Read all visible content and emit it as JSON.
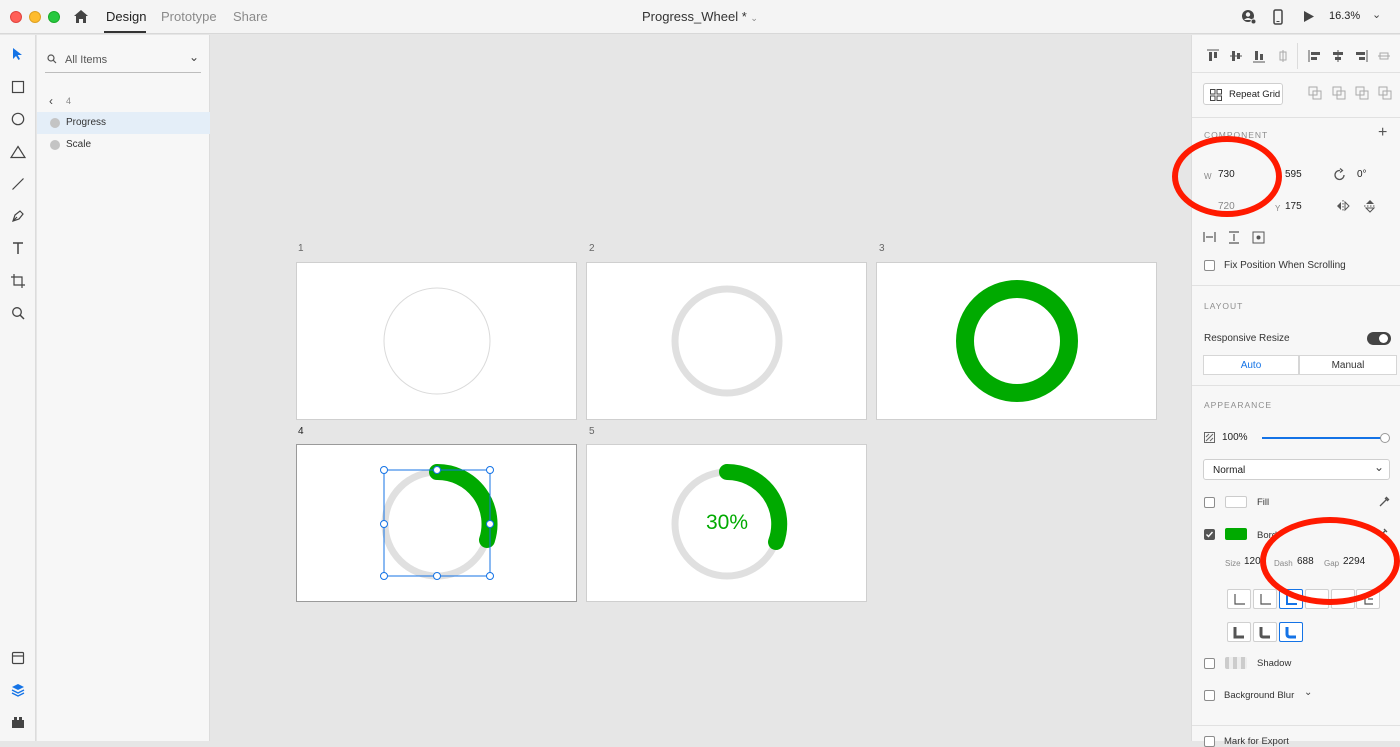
{
  "titlebar": {
    "tabs": [
      "Design",
      "Prototype",
      "Share"
    ],
    "doc_title": "Progress_Wheel *",
    "zoom": "16.3%"
  },
  "layers": {
    "search_placeholder": "All Items",
    "back_label": "4",
    "items": [
      "Progress",
      "Scale"
    ]
  },
  "artboards": [
    {
      "label": "1"
    },
    {
      "label": "2"
    },
    {
      "label": "3"
    },
    {
      "label": "4"
    },
    {
      "label": "5",
      "progress_text": "30%"
    }
  ],
  "inspector": {
    "repeat_grid": "Repeat Grid",
    "component_title": "COMPONENT",
    "w_label": "W",
    "w_value": "730",
    "h_value": "595",
    "rotation_value": "0°",
    "x_value": "720",
    "y_label": "Y",
    "y_value": "175",
    "fix_position": "Fix Position When Scrolling",
    "layout_title": "LAYOUT",
    "responsive_resize": "Responsive Resize",
    "seg_auto": "Auto",
    "seg_manual": "Manual",
    "appearance_title": "APPEARANCE",
    "opacity": "100%",
    "opacity_level": 1.0,
    "blend_mode": "Normal",
    "fill_label": "Fill",
    "border_label": "Bord",
    "size_label": "Size",
    "size_value": "120",
    "dash_label": "Dash",
    "dash_value": "688",
    "gap_label": "Gap",
    "gap_value": "2294",
    "shadow_label": "Shadow",
    "blur_label": "Background Blur",
    "export_label": "Mark for Export"
  },
  "colors": {
    "accent_blue": "#1473e6",
    "progress_green": "#00aa00",
    "track_gray": "#e0e0e0",
    "annotation_red": "#ff1a00"
  }
}
